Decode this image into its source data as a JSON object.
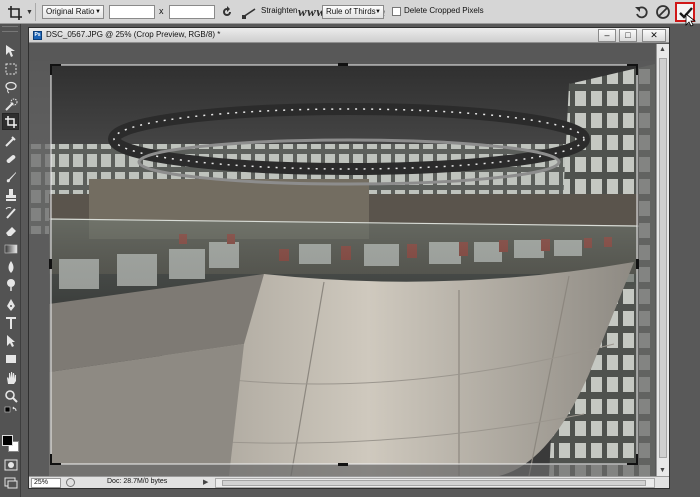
{
  "options_bar": {
    "ratio_select_value": "Original Ratio",
    "width_value": "",
    "height_value": "",
    "x_separator": "x",
    "straighten_label": "Straighten",
    "view_label": "View:",
    "view_select_value": "Rule of Thirds",
    "delete_cropped_label": "Delete Cropped Pixels",
    "watermark_text": "www.Psjia.com"
  },
  "document": {
    "title": "DSC_0567.JPG @ 25% (Crop Preview, RGB/8) *",
    "icon_label": "Ps",
    "minimize": "–",
    "maximize": "□",
    "close": "✕"
  },
  "status_bar": {
    "zoom": "25%",
    "doc_size": "Doc: 28.7M/0 bytes",
    "arrow": "▶"
  },
  "colors": {
    "commit_outline": "#d01818",
    "panel_bg": "#535353",
    "options_bg": "#d6d6d6"
  },
  "tools": [
    "move-tool",
    "marquee-tool",
    "lasso-tool",
    "quick-select-tool",
    "crop-tool",
    "eyedropper-tool",
    "healing-brush-tool",
    "brush-tool",
    "clone-stamp-tool",
    "history-brush-tool",
    "eraser-tool",
    "gradient-tool",
    "blur-tool",
    "dodge-tool",
    "pen-tool",
    "type-tool",
    "path-select-tool",
    "shape-tool",
    "hand-tool",
    "zoom-tool"
  ]
}
